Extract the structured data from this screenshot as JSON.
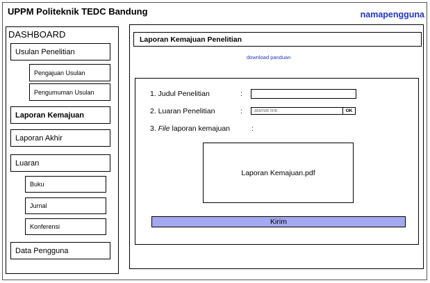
{
  "header": {
    "title": "UPPM Politeknik TEDC Bandung",
    "username": "namapengguna"
  },
  "sidebar": {
    "title": "DASHBOARD",
    "items": {
      "usulan": "Usulan Penelitian",
      "pengajuan": "Pengajuan Usulan",
      "pengumuman": "Pengumuman Usulan",
      "laporan_kemajuan": "Laporan Kemajuan",
      "laporan_akhir": "Laporan Akhir",
      "luaran": "Luaran",
      "buku": "Buku",
      "jurnal": "Jurnal",
      "konferensi": "Konferensi",
      "data_pengguna": "Data Pengguna"
    },
    "active": "Laporan Kemajuan"
  },
  "main": {
    "title": "Laporan Kemajuan Penelitian",
    "download_link": "download panduan",
    "form": {
      "judul_label": "1. Judul Penelitian",
      "judul_value": "",
      "luaran_label": "2. Luaran Penelitian",
      "luaran_placeholder": "alamat link",
      "ok_label": "OK",
      "file_label_prefix": "3. ",
      "file_label_italic": "File",
      "file_label_suffix": " laporan kemajuan",
      "colon": ":",
      "file_name": "Laporan Kemajuan.pdf",
      "submit_label": "Kirim"
    }
  },
  "colors": {
    "accent_blue": "#2233cc",
    "submit_bg": "#a3a8f0"
  }
}
